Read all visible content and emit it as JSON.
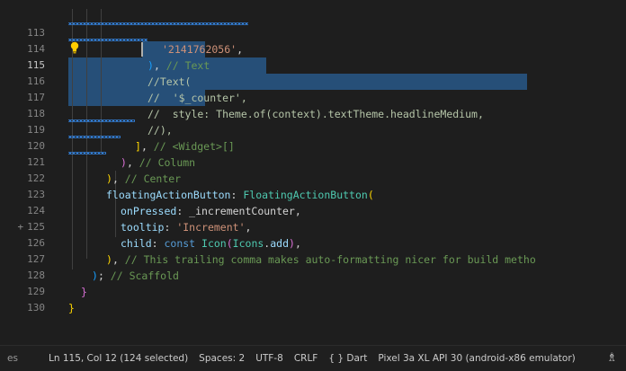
{
  "editor": {
    "lines": [
      {
        "num": "113",
        "tokens": [
          {
            "t": "'2141762056'",
            "c": "c-str"
          },
          {
            "t": ",",
            "c": "c-def"
          }
        ]
      },
      {
        "num": "114",
        "tokens": [
          {
            "t": ")",
            "c": "c-p3"
          },
          {
            "t": ", ",
            "c": "c-def"
          },
          {
            "t": "// Text",
            "c": "c-com"
          }
        ]
      },
      {
        "num": "115",
        "tokens": [
          {
            "t": "//Text(",
            "c": "c-comsel"
          }
        ]
      },
      {
        "num": "116",
        "tokens": [
          {
            "t": "//  '$_counter',",
            "c": "c-comsel"
          }
        ]
      },
      {
        "num": "117",
        "tokens": [
          {
            "t": "//  style: Theme.of(context).textTheme.headlineMedium,",
            "c": "c-comsel"
          }
        ]
      },
      {
        "num": "118",
        "tokens": [
          {
            "t": "//),",
            "c": "c-comsel"
          }
        ]
      },
      {
        "num": "119",
        "tokens": [
          {
            "t": "]",
            "c": "c-p2"
          },
          {
            "t": ", ",
            "c": "c-def"
          },
          {
            "t": "// <Widget>[]",
            "c": "c-com"
          }
        ]
      },
      {
        "num": "120",
        "tokens": [
          {
            "t": ")",
            "c": "c-p1"
          },
          {
            "t": ", ",
            "c": "c-def"
          },
          {
            "t": "// Column",
            "c": "c-com"
          }
        ]
      },
      {
        "num": "121",
        "tokens": [
          {
            "t": ")",
            "c": "c-p2"
          },
          {
            "t": ", ",
            "c": "c-def"
          },
          {
            "t": "// Center",
            "c": "c-com"
          }
        ]
      },
      {
        "num": "122",
        "tokens": [
          {
            "t": "floatingActionButton",
            "c": "c-prop"
          },
          {
            "t": ": ",
            "c": "c-def"
          },
          {
            "t": "FloatingActionButton",
            "c": "c-cls"
          },
          {
            "t": "(",
            "c": "c-p2"
          }
        ]
      },
      {
        "num": "123",
        "tokens": [
          {
            "t": "onPressed",
            "c": "c-prop"
          },
          {
            "t": ": _incrementCounter,",
            "c": "c-def"
          }
        ]
      },
      {
        "num": "124",
        "tokens": [
          {
            "t": "tooltip",
            "c": "c-prop"
          },
          {
            "t": ": ",
            "c": "c-def"
          },
          {
            "t": "'Increment'",
            "c": "c-str"
          },
          {
            "t": ",",
            "c": "c-def"
          }
        ]
      },
      {
        "num": "125",
        "tokens": [
          {
            "t": "child",
            "c": "c-prop"
          },
          {
            "t": ": ",
            "c": "c-def"
          },
          {
            "t": "const ",
            "c": "c-kw"
          },
          {
            "t": "Icon",
            "c": "c-cls"
          },
          {
            "t": "(",
            "c": "c-p1"
          },
          {
            "t": "Icons",
            "c": "c-cls"
          },
          {
            "t": ".",
            "c": "c-def"
          },
          {
            "t": "add",
            "c": "c-prop"
          },
          {
            "t": ")",
            "c": "c-p1"
          },
          {
            "t": ",",
            "c": "c-def"
          }
        ]
      },
      {
        "num": "126",
        "tokens": [
          {
            "t": ")",
            "c": "c-p2"
          },
          {
            "t": ", ",
            "c": "c-def"
          },
          {
            "t": "// This trailing comma makes auto-formatting nicer for build metho",
            "c": "c-com"
          }
        ]
      },
      {
        "num": "127",
        "tokens": [
          {
            "t": ")",
            "c": "c-p3"
          },
          {
            "t": "; ",
            "c": "c-def"
          },
          {
            "t": "// Scaffold",
            "c": "c-com"
          }
        ]
      },
      {
        "num": "128",
        "tokens": [
          {
            "t": "}",
            "c": "c-p1"
          }
        ]
      },
      {
        "num": "129",
        "tokens": [
          {
            "t": "}",
            "c": "c-p2"
          }
        ]
      },
      {
        "num": "130",
        "tokens": []
      }
    ],
    "diff_marker": "+",
    "active_line": "115"
  },
  "statusbar": {
    "left_fragment": "es",
    "position": "Ln 115, Col 12 (124 selected)",
    "spaces": "Spaces: 2",
    "encoding": "UTF-8",
    "eol": "CRLF",
    "language_icon": "{ }",
    "language": "Dart",
    "device": "Pixel 3a XL API 30 (android-x86 emulator)",
    "icons": {
      "feedback": "person-feedback-icon",
      "bulb": "lightbulb-icon"
    }
  },
  "colors": {
    "background": "#1e1e1e",
    "selection": "#264f78",
    "string": "#ce9178",
    "comment": "#6a9955",
    "property": "#9cdcfe",
    "class": "#4ec9b0",
    "keyword": "#569cd6"
  }
}
